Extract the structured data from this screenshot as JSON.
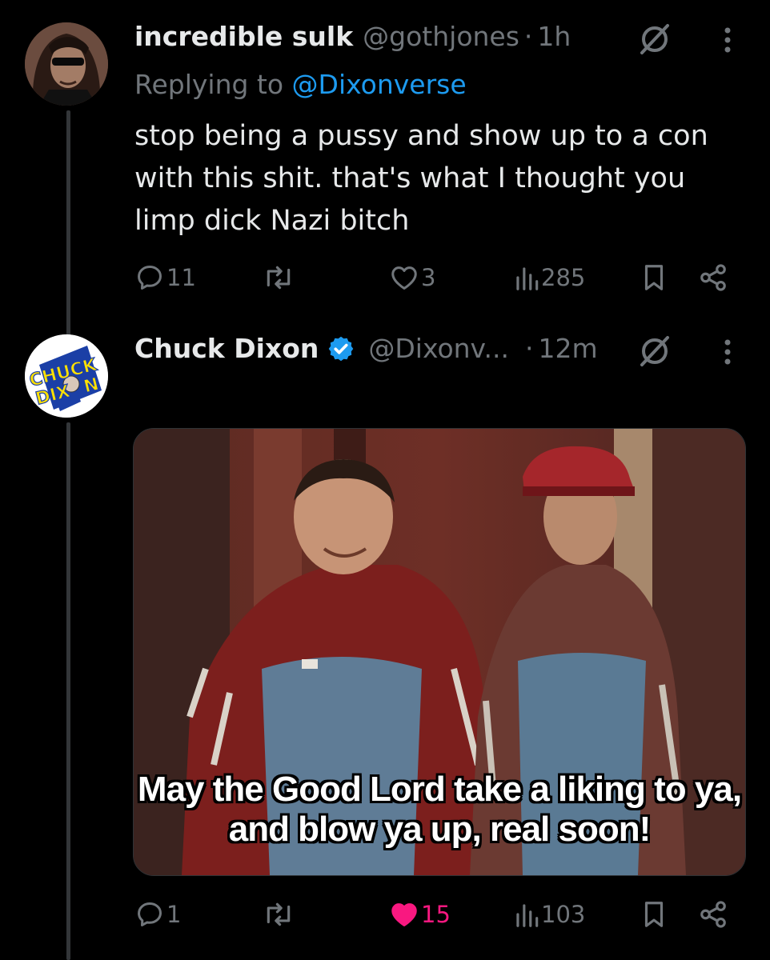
{
  "reply_tweet": {
    "author_name": "incredible sulk",
    "handle": "@gothjones",
    "separator": "·",
    "time": "1h",
    "replying_prefix": "Replying to",
    "replying_to": "@Dixonverse",
    "text_lines": [
      "stop being a pussy and show up to a con",
      "with this shit. that's what I thought you",
      "limp dick Nazi bitch"
    ],
    "actions": {
      "replies": "11",
      "reposts": "",
      "likes": "3",
      "views": "285"
    }
  },
  "main_tweet": {
    "author_name": "Chuck Dixon",
    "verified": true,
    "handle": "@Dixonv...",
    "separator": "·",
    "time": "12m",
    "avatar_text": [
      "CHUCK",
      "DIX",
      "N"
    ],
    "media": {
      "caption_lines": [
        "May the Good Lord take a liking to ya,",
        "and blow ya up, real soon!"
      ]
    },
    "actions": {
      "replies": "1",
      "reposts": "",
      "likes": "15",
      "liked": true,
      "views": "103"
    }
  },
  "icons": {
    "reply": "reply-icon",
    "repost": "repost-icon",
    "like": "heart-icon",
    "views": "views-icon",
    "bookmark": "bookmark-icon",
    "share": "share-icon",
    "grok": "grok-icon",
    "more": "more-icon",
    "verified": "verified-badge-icon"
  },
  "colors": {
    "background": "#000000",
    "text": "#e7e9ea",
    "secondary": "#71767b",
    "link": "#1d9bf0",
    "like": "#f91880",
    "verified": "#1d9bf0"
  }
}
